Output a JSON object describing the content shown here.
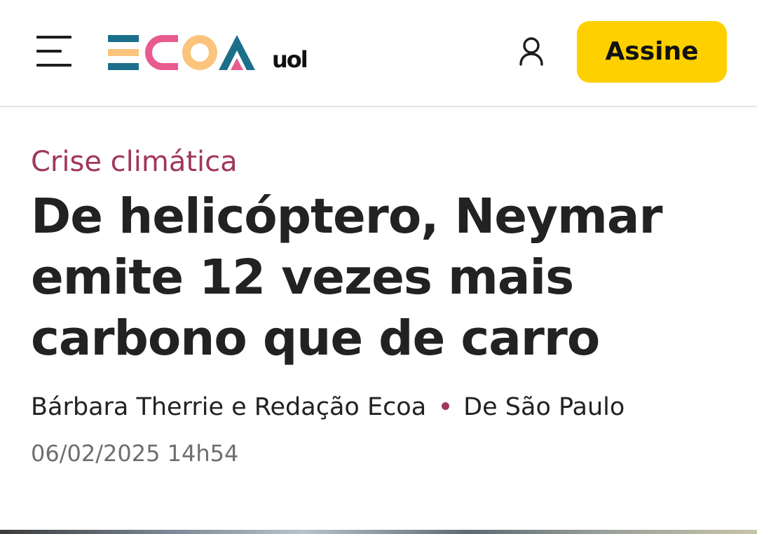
{
  "header": {
    "brand": "ECOA",
    "sub_brand": "uol",
    "subscribe_label": "Assine",
    "logo_colors": {
      "e": "#1c6f8a",
      "c": "#e85b8f",
      "o": "#fbc47c",
      "a": "#1c6f8a",
      "a_inner": "#e85b8f",
      "accent_yellow": "#ffd000"
    }
  },
  "article": {
    "category": "Crise climática",
    "headline": "De helicóptero, Neymar emite 12 vezes mais carbono que de carro",
    "authors": "Bárbara Therrie e Redação Ecoa",
    "location": "De São Paulo",
    "published": "06/02/2025 14h54"
  },
  "icons": {
    "menu": "hamburger-icon",
    "user": "user-icon",
    "separator": "dot-icon"
  },
  "colors": {
    "category": "#a0365c",
    "headline": "#222222",
    "timestamp": "#6e6e6e",
    "subscribe_bg": "#ffd000"
  }
}
